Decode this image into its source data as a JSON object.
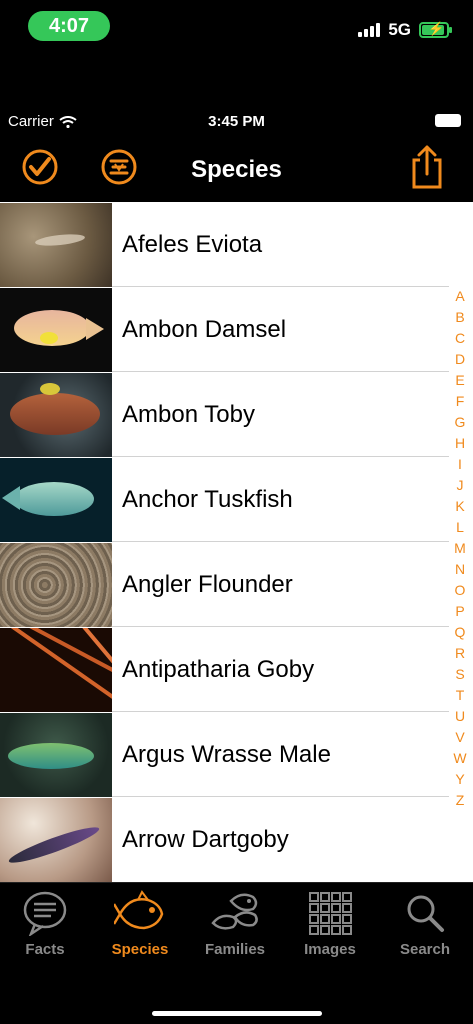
{
  "device_status": {
    "time": "4:07",
    "network": "5G"
  },
  "app_status": {
    "carrier": "Carrier",
    "time": "3:45 PM"
  },
  "navbar": {
    "title": "Species"
  },
  "species": [
    {
      "name": "Afeles Eviota"
    },
    {
      "name": "Ambon Damsel"
    },
    {
      "name": "Ambon Toby"
    },
    {
      "name": "Anchor Tuskfish"
    },
    {
      "name": "Angler Flounder"
    },
    {
      "name": "Antipatharia Goby"
    },
    {
      "name": "Argus Wrasse Male"
    },
    {
      "name": "Arrow Dartgoby"
    }
  ],
  "index_letters": [
    "A",
    "B",
    "C",
    "D",
    "E",
    "F",
    "G",
    "H",
    "I",
    "J",
    "K",
    "L",
    "M",
    "N",
    "O",
    "P",
    "Q",
    "R",
    "S",
    "T",
    "U",
    "V",
    "W",
    "Y",
    "Z"
  ],
  "tabs": [
    {
      "label": "Facts",
      "icon": "speech-bubble-icon",
      "active": false
    },
    {
      "label": "Species",
      "icon": "fish-icon",
      "active": true
    },
    {
      "label": "Families",
      "icon": "fish-family-icon",
      "active": false
    },
    {
      "label": "Images",
      "icon": "grid-icon",
      "active": false
    },
    {
      "label": "Search",
      "icon": "search-icon",
      "active": false
    }
  ],
  "colors": {
    "accent": "#f08a1d",
    "status_green": "#35c759",
    "inactive": "#8a8a8a"
  }
}
